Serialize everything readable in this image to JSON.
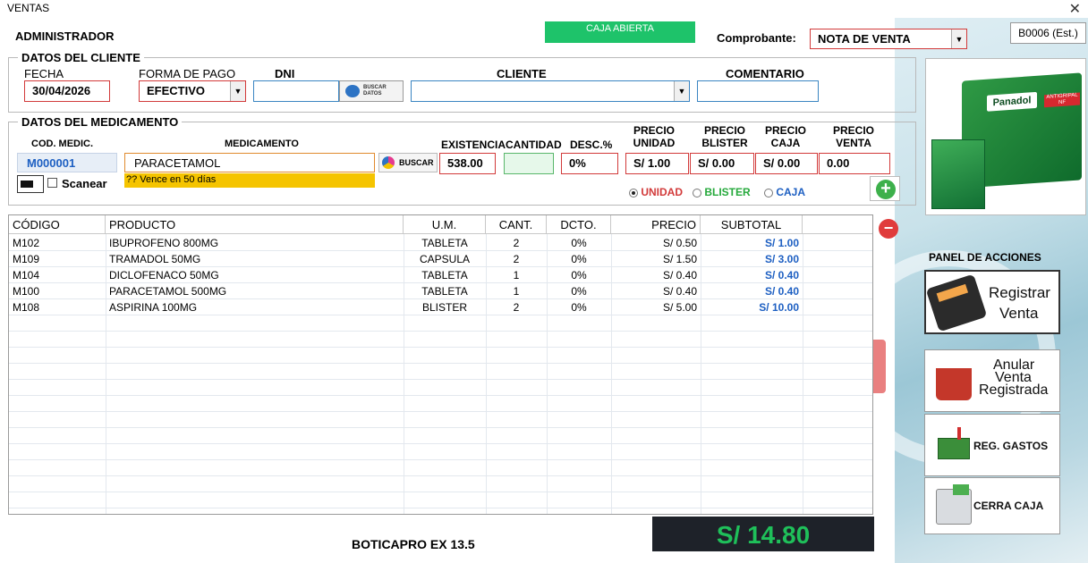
{
  "window": {
    "title": "VENTAS",
    "close": "✕"
  },
  "header": {
    "user": "ADMINISTRADOR",
    "caja_status": "CAJA ABIERTA",
    "comprobante_label": "Comprobante:",
    "comprobante_value": "NOTA DE VENTA",
    "serie": "B0006 (Est.)"
  },
  "cliente": {
    "section": "DATOS DEL CLIENTE",
    "fecha_label": "FECHA",
    "fecha": "30/04/2026",
    "forma_pago_label": "FORMA DE PAGO",
    "forma_pago": "EFECTIVO",
    "dni_label": "DNI",
    "dni": "",
    "buscar_datos": "BUSCAR DATOS",
    "cliente_label": "CLIENTE",
    "cliente": "",
    "comentario_label": "COMENTARIO",
    "comentario": ""
  },
  "medicamento": {
    "section": "DATOS DEL MEDICAMENTO",
    "cod_label": "COD. MEDIC.",
    "cod": "M000001",
    "med_label": "MEDICAMENTO",
    "med": "PARACETAMOL",
    "vence": "?? Vence en 50 días",
    "buscar": "BUSCAR",
    "scanear": "Scanear",
    "existencia_label": "EXISTENCIA",
    "existencia": "538.00",
    "cantidad_label": "CANTIDAD",
    "cantidad": "",
    "desc_label": "DESC.%",
    "desc": "0%",
    "precio_unidad_label": "PRECIO UNIDAD",
    "precio_unidad": "S/ 1.00",
    "precio_blister_label": "PRECIO BLISTER",
    "precio_blister": "S/ 0.00",
    "precio_caja_label": "PRECIO CAJA",
    "precio_caja": "S/ 0.00",
    "precio_venta_label": "PRECIO VENTA",
    "precio_venta": "0.00",
    "radio_unidad": "UNIDAD",
    "radio_blister": "BLISTER",
    "radio_caja": "CAJA"
  },
  "table": {
    "headers": [
      "CÓDIGO",
      "PRODUCTO",
      "U.M.",
      "CANT.",
      "DCTO.",
      "PRECIO",
      "SUBTOTAL"
    ],
    "rows": [
      [
        "M102",
        "IBUPROFENO 800MG",
        "TABLETA",
        "2",
        "0%",
        "S/ 0.50",
        "S/ 1.00"
      ],
      [
        "M109",
        "TRAMADOL 50MG",
        "CAPSULA",
        "2",
        "0%",
        "S/ 1.50",
        "S/ 3.00"
      ],
      [
        "M104",
        "DICLOFENACO 50MG",
        "TABLETA",
        "1",
        "0%",
        "S/ 0.40",
        "S/ 0.40"
      ],
      [
        "M100",
        "PARACETAMOL 500MG",
        "TABLETA",
        "1",
        "0%",
        "S/ 0.40",
        "S/ 0.40"
      ],
      [
        "M108",
        "ASPIRINA 100MG",
        "BLISTER",
        "2",
        "0%",
        "S/ 5.00",
        "S/ 10.00"
      ]
    ]
  },
  "footer": {
    "app": "BOTICAPRO EX  13.5",
    "total": "S/ 14.80"
  },
  "panel": {
    "title": "PANEL DE ACCIONES",
    "registrar": [
      "Registrar",
      "Venta"
    ],
    "anular": [
      "Anular",
      "Venta",
      "Registrada"
    ],
    "gastos": "REG. GASTOS",
    "cerrar": "CERRA CAJA"
  },
  "product_image": {
    "brand": "Panadol",
    "sub": "ANTIGRIPAL NF"
  },
  "colors": {
    "accent_red": "#d23a3a",
    "accent_blue": "#1d5fc2",
    "total_green": "#1fc05a",
    "caja_green": "#1ec36a"
  }
}
